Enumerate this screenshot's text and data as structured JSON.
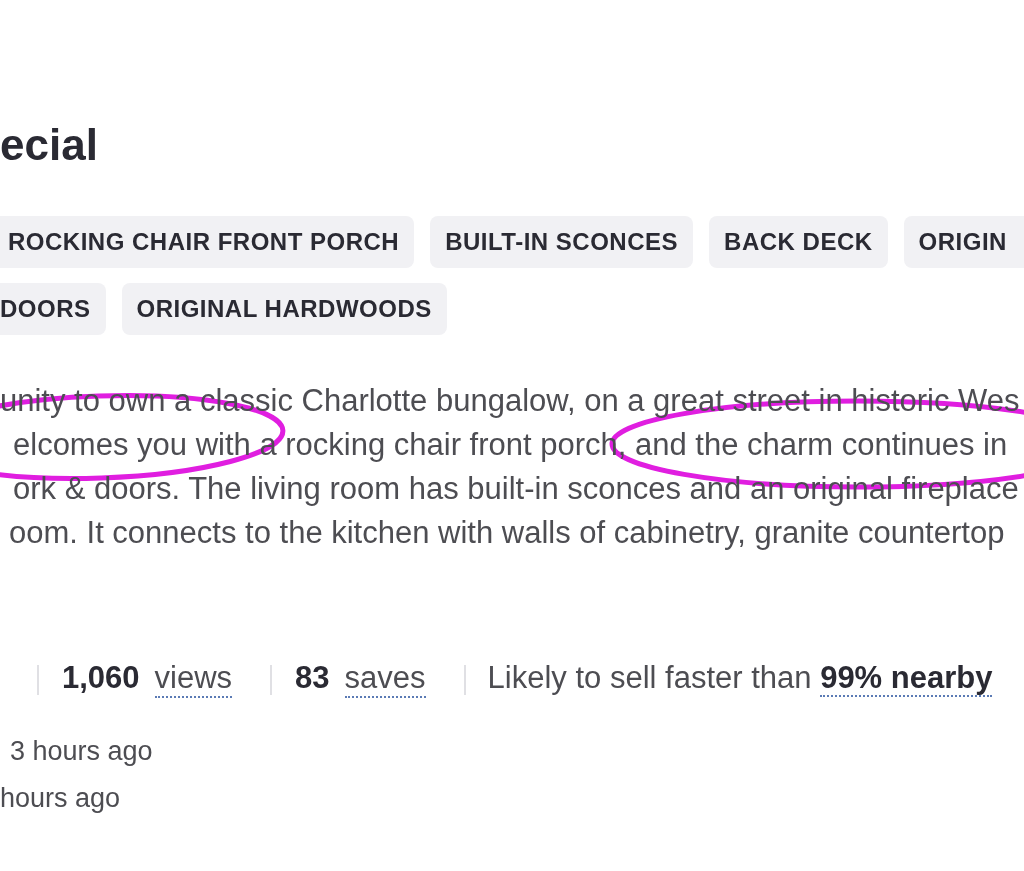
{
  "title": "ecial",
  "tag_rows": [
    [
      "ROCKING CHAIR FRONT PORCH",
      "BUILT-IN SCONCES",
      "BACK DECK",
      "ORIGIN"
    ],
    [
      "DOORS",
      "ORIGINAL HARDWOODS"
    ]
  ],
  "description": {
    "lines": [
      "unity to own a classic Charlotte bungalow, on a great street in historic Wes",
      "elcomes you with a rocking chair front porch, and the charm continues in",
      "ork & doors. The living room has built-in sconces and an original fireplace",
      "oom. It connects to the kitchen with walls of cabinetry, granite countertop"
    ]
  },
  "annotations": [
    {
      "kind": "ellipse"
    },
    {
      "kind": "ellipse"
    }
  ],
  "stats": [
    {
      "value": "1,060",
      "label": "views"
    },
    {
      "value": "83",
      "label": "saves"
    }
  ],
  "sell_speed": {
    "text": "Likely to sell faster than",
    "highlight": "99% nearby"
  },
  "timestamps": [
    "3 hours ago",
    "hours ago"
  ]
}
